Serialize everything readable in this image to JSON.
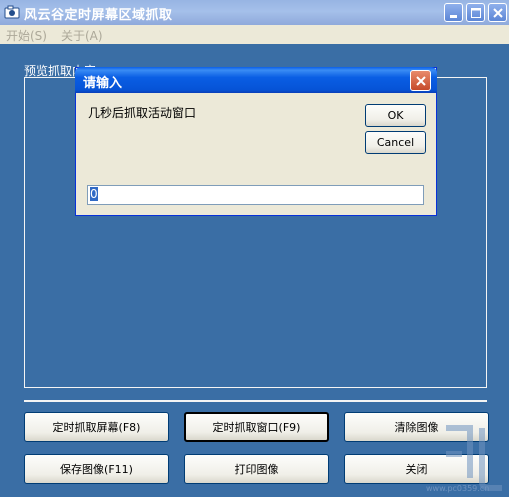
{
  "window": {
    "title": "风云谷定时屏幕区域抓取",
    "icon": "camera-icon"
  },
  "menu": {
    "items": [
      "开始(S)",
      "关于(A)"
    ]
  },
  "preview": {
    "label": "预览抓取内容："
  },
  "buttons": {
    "capture_screen": "定时抓取屏幕(F8)",
    "capture_window": "定时抓取窗口(F9)",
    "clear_image": "清除图像",
    "save_image": "保存图像(F11)",
    "print_image": "打印图像",
    "close": "关闭"
  },
  "dialog": {
    "title": "请输入",
    "prompt": "几秒后抓取活动窗口",
    "ok_label": "OK",
    "cancel_label": "Cancel",
    "input_value": "0"
  },
  "watermark": {
    "text": "www.pc0359.cn"
  },
  "colors": {
    "background": "#3a6ea5",
    "dialog_title": "#0653d6",
    "panel": "#ece9d8"
  }
}
